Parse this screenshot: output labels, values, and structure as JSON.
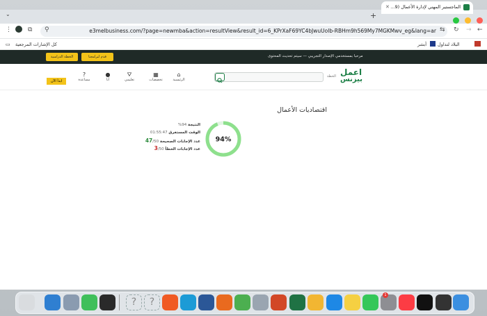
{
  "browser": {
    "tab_title": "الماجستير المهني لإدارة الأعمال (9...",
    "url": "e3melbusiness.com/?page=newmba&action=resultView&result_id=6_KPrXaF69YC4bJwuUolb-RBHm9h569My7MGKMwv_eg&lang=ar"
  },
  "bookmarks": {
    "all_bookmarks": "كل الإشارات المرجعية",
    "items": [
      "البلاد لتداول",
      "أبشر"
    ]
  },
  "site": {
    "buttons": {
      "apply": "قدم لبرامجنا",
      "pathway": "الخطة الدراسية"
    },
    "announcement": "مرحبا بمستخدمي الإصدار التجريبي — سيتم تحديث المحتوى",
    "logo_line1": "اعمل",
    "logo_line2": "بيزنس",
    "logo_side": "الخطة",
    "nav": {
      "home": "الرئيسية",
      "programs": "تخصصات",
      "learning": "تعليمي",
      "account": "أنا",
      "help": "مساعدة",
      "login": "ابدأ الآن"
    }
  },
  "result": {
    "title": "اقتصاديات الأعمال",
    "percent": "94%",
    "percent_value": 94,
    "labels": {
      "score": "النتيجة",
      "time": "الوقت المستغرق",
      "correct": "عدد الإجابات الصحيحة",
      "wrong": "عدد الإجابات الخطأ"
    },
    "values": {
      "score": "94%",
      "time": "01:55:47",
      "correct": "47",
      "correct_total": "/50",
      "wrong": "3",
      "wrong_total": "/50"
    }
  },
  "colors": {
    "accent": "#1c7f46",
    "ring_fill": "#8ee08d",
    "ring_track": "#e3f5e4",
    "yellow": "#f3c319"
  },
  "dock": {
    "apps": [
      "trash-icon",
      "system-settings-icon",
      "preview-icon",
      "find-my-icon",
      "terminal-icon",
      "unknown-app-icon",
      "unknown-app-icon",
      "brave-icon",
      "edge-icon",
      "word-icon",
      "firefox-icon",
      "chrome-icon",
      "launchpad-icon",
      "powerpoint-icon",
      "excel-icon",
      "photos-icon",
      "app-store-icon",
      "notes-icon",
      "facetime-icon",
      "settings-icon",
      "music-icon",
      "apple-tv-icon",
      "piano-icon",
      "finder-icon"
    ],
    "settings_badge": "1"
  }
}
